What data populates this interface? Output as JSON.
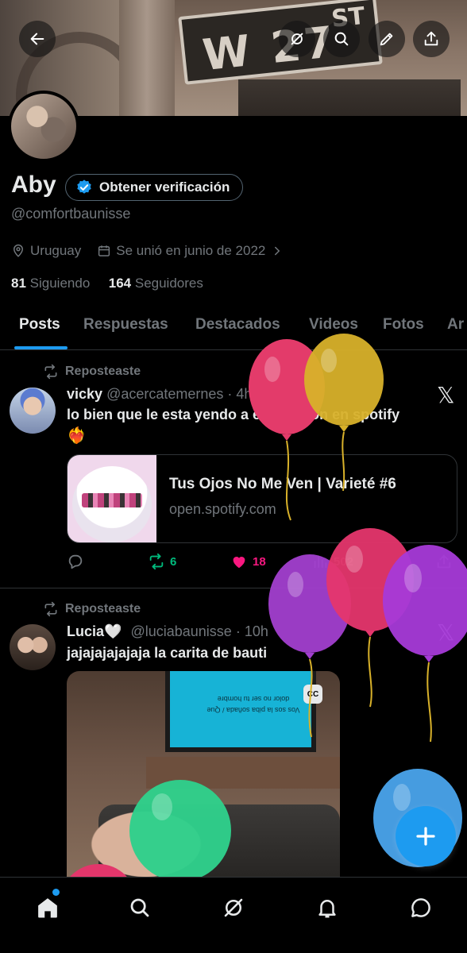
{
  "banner": {
    "sign_text": "W 27",
    "sign_sup": "ST"
  },
  "profile": {
    "name": "Aby",
    "verify_label": "Obtener verificación",
    "handle": "@comfortbaunisse",
    "location": "Uruguay",
    "joined": "Se unió en junio de 2022",
    "following_count": "81",
    "following_label": "Siguiendo",
    "followers_count": "164",
    "followers_label": "Seguidores"
  },
  "tabs": [
    {
      "label": "Posts"
    },
    {
      "label": "Respuestas"
    },
    {
      "label": "Destacados"
    },
    {
      "label": "Videos"
    },
    {
      "label": "Fotos"
    },
    {
      "label": "Ar"
    }
  ],
  "posts": [
    {
      "repost_label": "Reposteaste",
      "author_name": "vicky",
      "author_handle": "@acercatemernes",
      "time": "· 4h",
      "text_line1": "lo bien que le esta yendo a este temon en spotify",
      "text_line2": "❤️‍🔥",
      "card_title": "Tus Ojos No Me Ven | Varieté #6",
      "card_url": "open.spotify.com",
      "reposts": "6",
      "likes": "18",
      "views": "502"
    },
    {
      "repost_label": "Reposteaste",
      "author_name": "Lucia🤍",
      "author_handle": "@luciabaunisse",
      "time": "· 10h",
      "text": "jajajajajajaja la carita de bauti",
      "tv_text": "Vos sos la piba soñada / Que dolor no ser tu hombre",
      "cc_label": "CC"
    }
  ],
  "colors": {
    "accent": "#1d9bf0",
    "repost_green": "#00ba7c",
    "like_pink": "#f91880",
    "muted": "#71767b"
  },
  "icons": {
    "back": "arrow-left-icon",
    "grok": "grok-icon",
    "search": "search-icon",
    "edit": "pencil-icon",
    "share": "share-icon",
    "verified": "verified-badge-icon",
    "location": "location-pin-icon",
    "calendar": "calendar-icon",
    "repost": "repost-icon",
    "reply": "reply-icon",
    "like": "heart-icon",
    "views": "views-icon",
    "compose": "plus-icon",
    "home": "home-icon",
    "notifications": "bell-icon",
    "messages": "message-icon"
  },
  "balloons": [
    {
      "color": "#e33b6a"
    },
    {
      "color": "#d8b12a"
    },
    {
      "color": "#a23fcf"
    },
    {
      "color": "#e5366d"
    },
    {
      "color": "#a63ad8"
    },
    {
      "color": "#4aa4ec"
    },
    {
      "color": "#2fd08b"
    },
    {
      "color": "#e3366b"
    }
  ]
}
